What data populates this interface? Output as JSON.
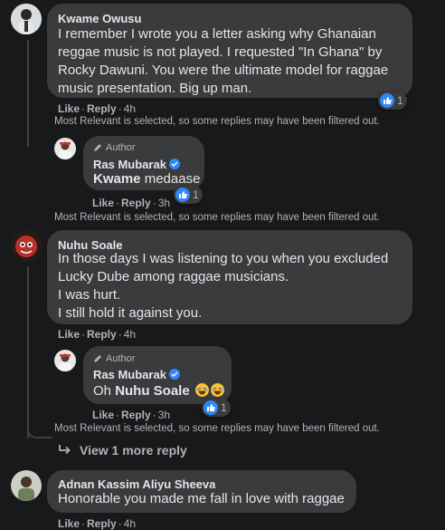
{
  "colors": {
    "background": "#18191a",
    "bubble": "#3a3b3c",
    "like_blue": "#2d88ff",
    "secondary_text": "#b0b3b8"
  },
  "filter_note": "Most Relevant is selected, so some replies may have been filtered out.",
  "actions": {
    "like": "Like",
    "reply": "Reply"
  },
  "comments": [
    {
      "author": "Kwame Owusu",
      "lines": [
        "I remember I wrote you a letter asking why Ghanaian",
        "reggae music is not played. I requested \"In Ghana\" by",
        "Rocky Dawuni. You were the ultimate model for raggae",
        "music presentation. Big up man."
      ],
      "time": "4h",
      "reaction_count": "1",
      "reply": {
        "author_tag": "Author",
        "author": "Ras Mubarak",
        "mention": "Kwame",
        "text": " medaase",
        "time": "3h",
        "reaction_count": "1"
      }
    },
    {
      "author": "Nuhu Soale",
      "lines": [
        "In those days I was listening to you when you excluded",
        "Lucky Dube among raggae musicians.",
        "I was hurt.",
        "I still hold it against you."
      ],
      "time": "4h",
      "reply": {
        "author_tag": "Author",
        "author": "Ras Mubarak",
        "prefix": "Oh ",
        "mention": "Nuhu Soale",
        "time": "3h",
        "reaction_count": "1"
      },
      "view_more": "View 1 more reply"
    },
    {
      "author": "Adnan Kassim Aliyu Sheeva",
      "lines": [
        "Honorable you made me fall in love with raggae"
      ],
      "time": "4h"
    }
  ]
}
